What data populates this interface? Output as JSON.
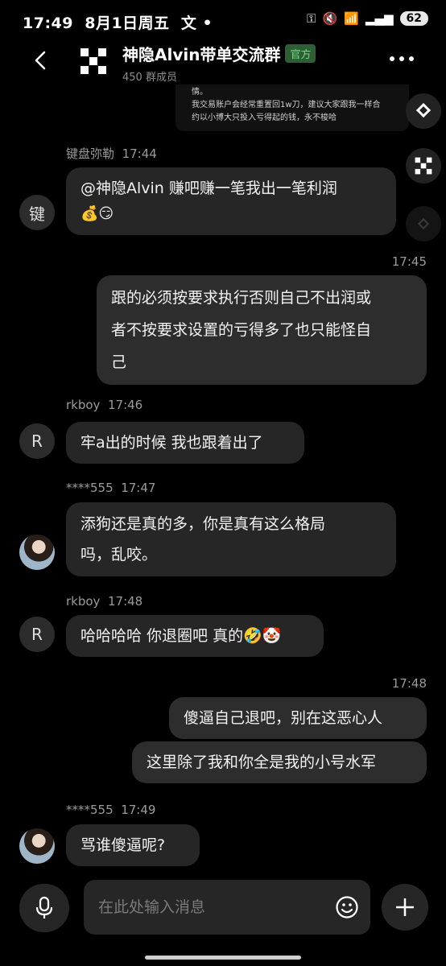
{
  "status_bar": {
    "time": "17:49",
    "date": "8月1日周五",
    "ime": "文",
    "battery": "62"
  },
  "header": {
    "group_name": "神隐Alvin带单交流群",
    "official_badge": "官方",
    "members": "450 群成员"
  },
  "snippet": {
    "line1": "情。",
    "line2": "我交易账户会经常重置回1w刀，建议大家跟我一样合",
    "line3": "约以小博大只投入亏得起的钱，永不梭哈"
  },
  "messages": [
    {
      "sender": "键盘弥勒",
      "time": "17:44",
      "avatar": "键",
      "lines": [
        "@神隐Alvin 赚吧赚一笔我出一笔利润",
        "💰😏"
      ]
    },
    {
      "time": "17:45",
      "lines": [
        "跟的必须按要求执行否则自己不出润或",
        "者不按要求设置的亏得多了也只能怪自",
        "己"
      ]
    },
    {
      "sender": "rkboy",
      "time": "17:46",
      "avatar": "R",
      "lines": [
        "牢a出的时候 我也跟着出了"
      ]
    },
    {
      "sender": "****555",
      "time": "17:47",
      "lines": [
        "添狗还是真的多，你是真有这么格局",
        "吗，乱咬。"
      ]
    },
    {
      "sender": "rkboy",
      "time": "17:48",
      "avatar": "R",
      "lines": [
        "哈哈哈哈 你退圈吧 真的🤣🤡"
      ]
    },
    {
      "time": "17:48",
      "lines": [
        "傻逼自己退吧，别在这恶心人"
      ]
    },
    {
      "lines": [
        "这里除了我和你全是我的小号水军"
      ]
    },
    {
      "sender": "****555",
      "time": "17:49",
      "lines": [
        "骂谁傻逼呢?"
      ]
    }
  ],
  "input": {
    "placeholder": "在此处输入消息"
  },
  "colors": {
    "background": "#000000",
    "bubble": "#262626",
    "official_green": "#6fdc7a"
  },
  "icons": [
    "back-arrow-icon",
    "group-logo-icon",
    "more-icon",
    "share-icon",
    "app-logo-icon",
    "binance-icon",
    "mic-icon",
    "smile-icon",
    "plus-icon"
  ]
}
